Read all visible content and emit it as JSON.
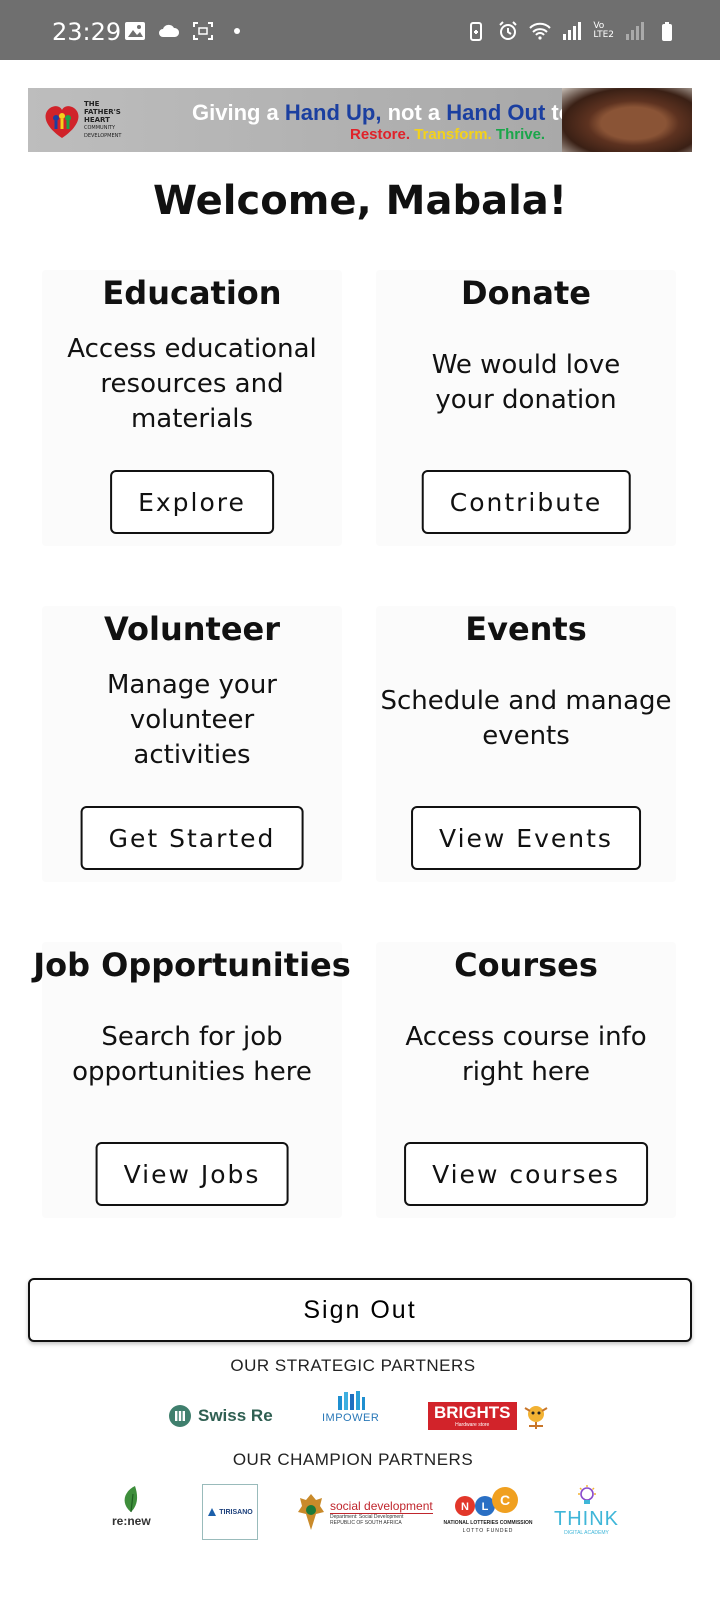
{
  "status_bar": {
    "time": "23:29",
    "left_icons": [
      "image-icon",
      "cloud-icon",
      "screenshot-icon",
      "dot-icon"
    ],
    "right_icons": [
      "battery-saver-icon",
      "alarm-icon",
      "wifi-icon",
      "signal-icon",
      "volte-icon",
      "signal-weak-icon",
      "battery-icon"
    ],
    "volte_label": "Vo\nLTE2"
  },
  "banner": {
    "org_name": "THE FATHER'S HEART",
    "org_sub": "COMMUNITY DEVELOPMENT",
    "tagline_giving": "Giving a",
    "tagline_handup": "Hand Up,",
    "tagline_not": "not a",
    "tagline_handout": "Hand Out",
    "tagline_to": "to",
    "word_restore": "Restore.",
    "word_transform": "Transform.",
    "word_thrive": "Thrive."
  },
  "welcome": "Welcome, Mabala!",
  "cards": [
    {
      "title": "Education",
      "description": "Access educational resources and materials",
      "button": "Explore"
    },
    {
      "title": "Donate",
      "description": "We would love your donation",
      "button": "Contribute"
    },
    {
      "title": "Volunteer",
      "description": "Manage your volunteer activities",
      "button": "Get Started"
    },
    {
      "title": "Events",
      "description": "Schedule and manage events",
      "button": "View Events"
    },
    {
      "title": "Job Opportunities",
      "description": "Search for job opportunities here",
      "button": "View Jobs"
    },
    {
      "title": "Courses",
      "description": "Access course info right here",
      "button": "View courses"
    }
  ],
  "sign_out": "Sign Out",
  "strategic_partners": {
    "heading": "OUR STRATEGIC PARTNERS",
    "swiss_re": "Swiss Re",
    "impower": "IMPOWER",
    "brights": "BRIGHTS",
    "brights_sub": "Hardware store"
  },
  "champion_partners": {
    "heading": "OUR CHAMPION PARTNERS",
    "renew": "re:new",
    "tirisano": "TIRISANO",
    "social_dev": "social development",
    "social_dev_sub": "Department: Social Development REPUBLIC OF SOUTH AFRICA",
    "nlc_letters": "N L C",
    "nlc_name": "NATIONAL LOTTERIES COMMISSION",
    "nlc_sub": "LOTTO FUNDED",
    "think": "THINK",
    "think_sub": "DIGITAL ACADEMY"
  },
  "colors": {
    "status_bar": "#6f6f6f",
    "brand_blue": "#1b3fa0",
    "restore_red": "#e0222a",
    "transform_yellow": "#f3d21b",
    "thrive_green": "#1aa64a",
    "brights_red": "#d2232a",
    "swiss_green": "#3f7f6d"
  }
}
